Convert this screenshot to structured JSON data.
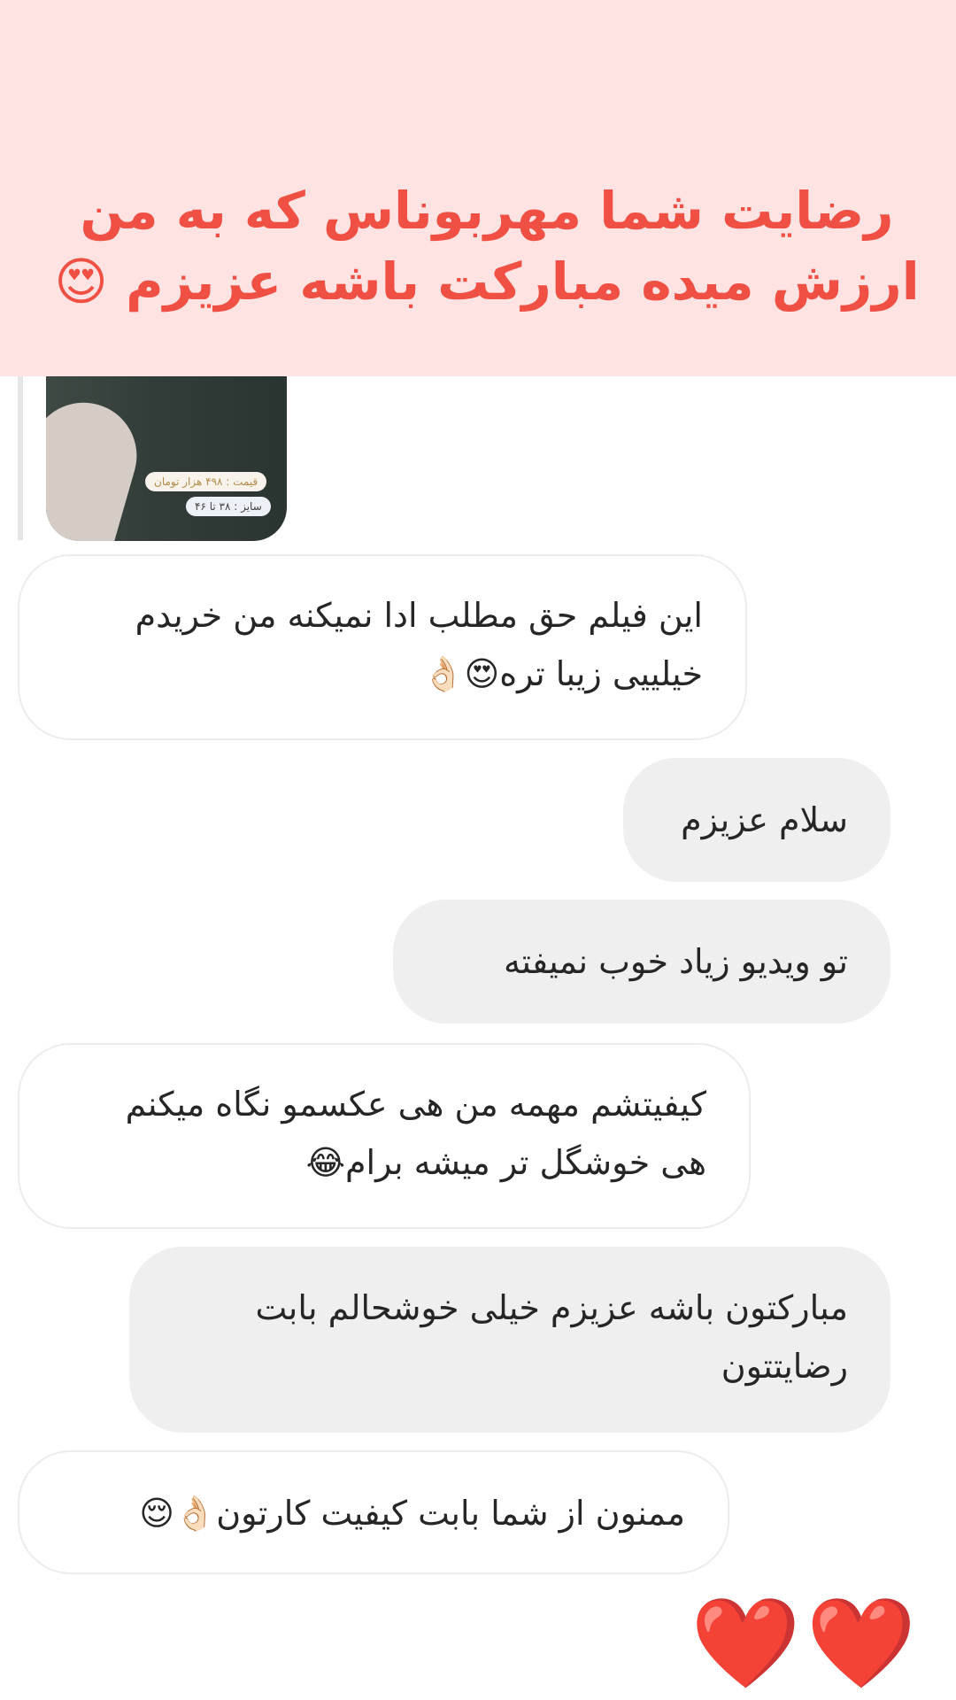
{
  "banner": {
    "caption": "رضایت شما مهربوناس که به من ارزش میده مبارکت باشه عزیزم 😍"
  },
  "preview": {
    "price_tag": "قیمت : ۴۹۸ هزار تومان",
    "size_tag": "سایز : ۳۸ تا ۴۶"
  },
  "messages": [
    {
      "from": "customer",
      "text": "این فیلم حق مطلب ادا نمیکنه من خریدم خیلییی زیبا تره😍👌🏻"
    },
    {
      "from": "seller",
      "text": "سلام عزیزم"
    },
    {
      "from": "seller",
      "text": "تو ویدیو زیاد خوب نمیفته"
    },
    {
      "from": "customer",
      "text": "کیفیتشم مهمه من هی عکسمو نگاه میکنم هی خوشگل تر میشه برام😂"
    },
    {
      "from": "seller",
      "text": "مبارکتون باشه عزیزم خیلی خوشحالم بابت رضایتتون"
    },
    {
      "from": "customer",
      "text": "ممنون از شما بابت کیفیت کارتون👌🏻😌"
    }
  ],
  "reaction": "❤️❤️"
}
